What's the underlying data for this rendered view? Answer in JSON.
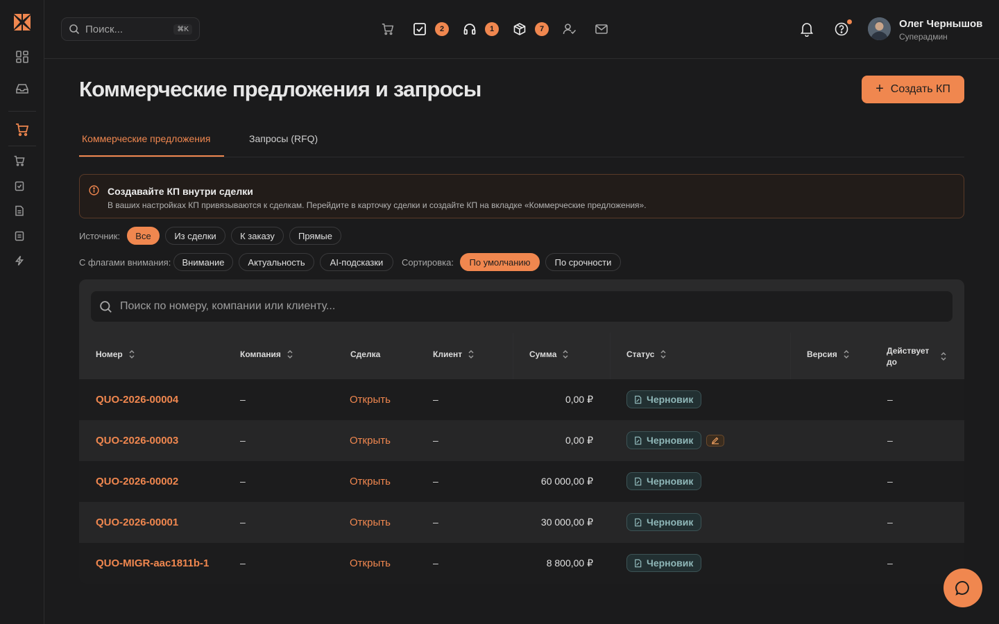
{
  "header": {
    "search_placeholder": "Поиск...",
    "search_shortcut": "⌘K",
    "badges": {
      "tasks": "2",
      "support": "1",
      "packages": "7"
    },
    "user_name": "Олег Чернышов",
    "user_role": "Суперадмин"
  },
  "page": {
    "title": "Коммерческие предложения и запросы",
    "create_button": "Создать КП"
  },
  "tabs": [
    {
      "label": "Коммерческие предложения",
      "active": true
    },
    {
      "label": "Запросы (RFQ)",
      "active": false
    }
  ],
  "alert": {
    "title": "Создавайте КП внутри сделки",
    "text": "В ваших настройках КП привязываются к сделкам. Перейдите в карточку сделки и создайте КП на вкладке «Коммерческие предложения»."
  },
  "filters": {
    "source_label": "Источник:",
    "source_options": [
      "Все",
      "Из сделки",
      "К заказу",
      "Прямые"
    ],
    "flags_label": "С флагами внимания:",
    "flag_options": [
      "Внимание",
      "Актуальность",
      "AI-подсказки"
    ],
    "sort_label": "Сортировка:",
    "sort_options": [
      "По умолчанию",
      "По срочности"
    ]
  },
  "table": {
    "search_placeholder": "Поиск по номеру, компании или клиенту...",
    "columns": {
      "number": "Номер",
      "company": "Компания",
      "deal": "Сделка",
      "client": "Клиент",
      "sum": "Сумма",
      "status": "Статус",
      "version": "Версия",
      "valid_until_1": "Действует",
      "valid_until_2": "до"
    },
    "rows": [
      {
        "number": "QUO-2026-00004",
        "company": "–",
        "deal": "Открыть",
        "client": "–",
        "sum": "0,00 ₽",
        "status": "Черновик",
        "version": "",
        "valid": "–"
      },
      {
        "number": "QUO-2026-00003",
        "company": "–",
        "deal": "Открыть",
        "client": "–",
        "sum": "0,00 ₽",
        "status": "Черновик",
        "version": "",
        "valid": "–"
      },
      {
        "number": "QUO-2026-00002",
        "company": "–",
        "deal": "Открыть",
        "client": "–",
        "sum": "60 000,00 ₽",
        "status": "Черновик",
        "version": "",
        "valid": "–"
      },
      {
        "number": "QUO-2026-00001",
        "company": "–",
        "deal": "Открыть",
        "client": "–",
        "sum": "30 000,00 ₽",
        "status": "Черновик",
        "version": "",
        "valid": "–"
      },
      {
        "number": "QUO-MIGR-aac1811b-1",
        "company": "–",
        "deal": "Открыть",
        "client": "–",
        "sum": "8 800,00 ₽",
        "status": "Черновик",
        "version": "",
        "valid": "–"
      }
    ]
  },
  "colors": {
    "accent": "#f0874f",
    "background": "#1b1b1c",
    "status_teal": "#8fb7b8"
  }
}
